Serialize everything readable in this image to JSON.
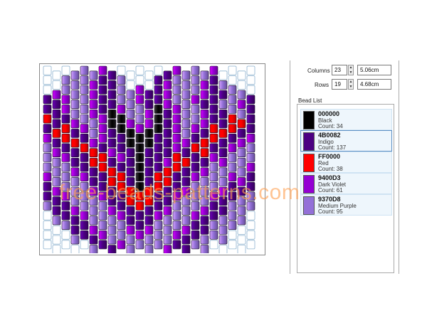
{
  "controls": {
    "columns_label": "Columns",
    "columns_value": "23",
    "columns_cm": "5.06cm",
    "rows_label": "Rows",
    "rows_value": "19",
    "rows_cm": "4.68cm"
  },
  "bead_list": {
    "title": "Bead List",
    "items": [
      {
        "code": "000000",
        "name": "Black",
        "count": "Count: 34",
        "color": "#000000"
      },
      {
        "code": "4B0082",
        "name": "Indigo",
        "count": "Count: 137",
        "color": "#4B0082"
      },
      {
        "code": "FF0000",
        "name": "Red",
        "count": "Count: 38",
        "color": "#FF0000"
      },
      {
        "code": "9400D3",
        "name": "Dark Violet",
        "count": "Count: 61",
        "color": "#9400D3"
      },
      {
        "code": "9370D8",
        "name": "Medium Purple",
        "count": "Count: 95",
        "color": "#9370D8"
      }
    ]
  },
  "pattern": {
    "columns": 23,
    "rows": 19,
    "legend": {
      ".": "#ffffff",
      "K": "#000000",
      "I": "#4B0082",
      "R": "#FF0000",
      "V": "#9400D3",
      "M": "#9370D8"
    },
    "grid": [
      "...MMMVI.....IVMMMV....",
      "..MMMVIIM...IVMMMVIM...",
      ".VMMMVIIMMVIIVMMMVIIMM.",
      "IIVMMVIIMMVIIVMMVIIMMVI",
      "IIVMMVIKVMMVKIVMMVIIMMI",
      "RIIVMMVKKVMVKIVMMVIIRRI",
      "IRRIVMVIKKVKKIVMVIRRRII",
      "VIRRIVVIIKKKIIVVIRRIIVV",
      "MVIIRRIVIIKIIIVIRRIIVMM",
      "MMVIIRRIVIKIIVRRIIVVMMM",
      "MMMVIIRRIIKIIRRIIVMMMMV",
      "VMMMVIIRRIKIRRIIVMMMVVI",
      "IVMMMVIIRRKRRIIVMMMVIII",
      "IIVMMMVIIRRRIIVMMMVIIMM",
      "MIIVMMMVIIRIIVMMMVIIMMM",
      ".MIIVMMMVIIIVMMMVIIMMM.",
      "..MIIVMMMVIVMMMVIIMMM..",
      "...MIIVMMMVMMMVIIMMM...",
      ".....MIIVMMMMVIIMM....."
    ]
  },
  "watermark": "free-beads-patterns.com"
}
